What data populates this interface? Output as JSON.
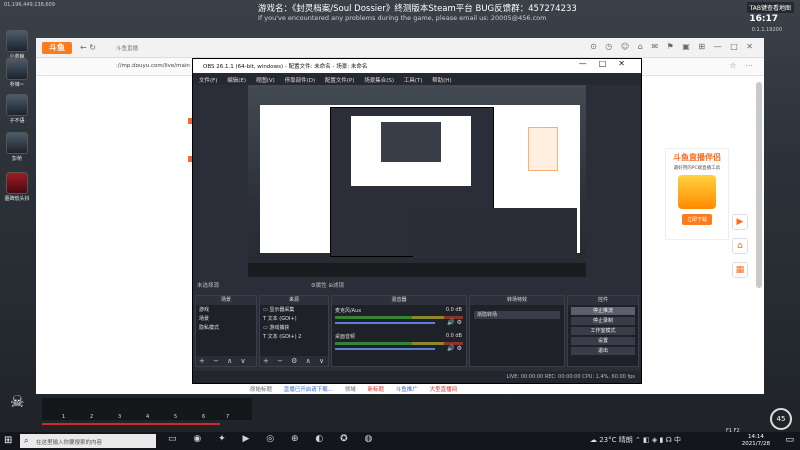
{
  "game": {
    "id_text": "01,196,449,138,609",
    "title": "游戏名：《封灵档案/Soul Dossier》终测版本Steam平台 BUG反馈群：457274233",
    "subtitle": "If you've encountered any problems during the game, please email us: 20005@456.com",
    "tab_hint": "TAB键查看地图",
    "clock": "16:17",
    "version": "0.1.1.19200",
    "players": [
      "小蓝鲸",
      "朴锋~",
      "子不语",
      "彭桥",
      "墓碑低头抖"
    ],
    "hotbar_numbers": [
      "1",
      "2",
      "3",
      "4",
      "5",
      "6",
      "7"
    ],
    "fkeys": "F1   F2",
    "right_hud": "45"
  },
  "browser": {
    "tab_title": "斗鱼直播",
    "url": "://mp.douyu.com/live/main",
    "logo": "斗鱼",
    "nav_icons": "← ↻",
    "right_icons": "⊙ ◷ ☺ ⌂ ✉ ⚑ ▣ ⊞ — □ ✕"
  },
  "promo": {
    "title": "斗鱼直播伴侣",
    "subtitle": "最好用的PC端直播工具",
    "button": "立即下载"
  },
  "footer": {
    "items": [
      "原始标题",
      "直播已开启请下载...",
      "领域",
      "新标题",
      "斗鱼推广",
      "大型直播间"
    ]
  },
  "obs": {
    "title": "OBS 26.1.1 (64-bit, windows) - 配置文件: 未命名 - 场景: 未命名",
    "menu": [
      "文件(F)",
      "编辑(E)",
      "视图(V)",
      "停靠部件(D)",
      "配置文件(P)",
      "场景集合(S)",
      "工具(T)",
      "帮助(H)"
    ],
    "status_row": "未选择源",
    "status_props": "⚙属性   ⊞滤镜",
    "scenes": {
      "header": "场景",
      "items": [
        "游戏",
        "场景",
        "隐私模式"
      ]
    },
    "sources": {
      "header": "来源",
      "items": [
        "显示器采集",
        "文本 (GDI+)",
        "游戏捕获",
        "文本 (GDI+) 2"
      ]
    },
    "mixer": {
      "header": "混音器",
      "channels": [
        {
          "name": "麦克风/Aux",
          "db": "0.0 dB"
        },
        {
          "name": "桌面音频",
          "db": "0.0 dB"
        }
      ]
    },
    "transitions": {
      "header": "转场特效",
      "selected": "渐隐转场"
    },
    "controls": {
      "header": "控件",
      "buttons": [
        "停止推流",
        "停止录制",
        "工作室模式",
        "设置",
        "退出"
      ]
    },
    "statusbar": "LIVE: 00:00:00   REC: 00:00:00   CPU: 1.4%, 60.00 fps"
  },
  "taskbar": {
    "search_placeholder": "在这里输入你要搜索的内容",
    "start_icon": "⊞",
    "apps": "▭ ◉ ✦ ▶ ◎ ⊕ ◐ ✪ ◍",
    "tray": "☁ 23°C 晴朗 ⌃ ◧ ◈ ▮ ☊ 中",
    "time": "14:14",
    "date": "2021/7/28"
  }
}
